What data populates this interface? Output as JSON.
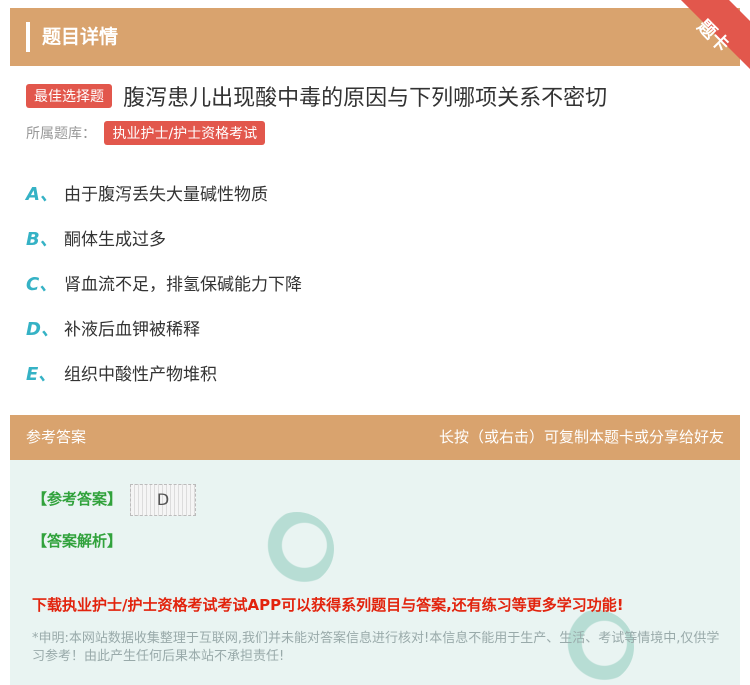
{
  "header": {
    "title": "题目详情",
    "corner_tag": "题卡"
  },
  "question": {
    "type_tag": "最佳选择题",
    "text": "腹泻患儿出现酸中毒的原因与下列哪项关系不密切",
    "bank_label": "所属题库：",
    "bank_tag": "执业护士/护士资格考试"
  },
  "options": [
    {
      "letter": "A、",
      "text": "由于腹泻丢失大量碱性物质"
    },
    {
      "letter": "B、",
      "text": "酮体生成过多"
    },
    {
      "letter": "C、",
      "text": "肾血流不足，排氢保碱能力下降"
    },
    {
      "letter": "D、",
      "text": "补液后血钾被稀释"
    },
    {
      "letter": "E、",
      "text": "组织中酸性产物堆积"
    }
  ],
  "answer_section": {
    "title": "参考答案",
    "hint": "长按（或右击）可复制本题卡或分享给好友",
    "answer_label": "【参考答案】",
    "answer_value": "D",
    "analysis_label": "【答案解析】",
    "promo": "下载执业护士/护士资格考试考试APP可以获得系列题目与答案,还有练习等更多学习功能!",
    "notice": "*申明:本网站数据收集整理于互联网,我们并未能对答案信息进行核对!本信息不能用于生产、生活、考试等情境中,仅供学习参考！由此产生任何后果本站不承担责任!"
  },
  "colors": {
    "header": "#d9a36e",
    "accent_red": "#e2574c",
    "option_letter": "#35b2c5",
    "answer_green": "#31a23c"
  }
}
